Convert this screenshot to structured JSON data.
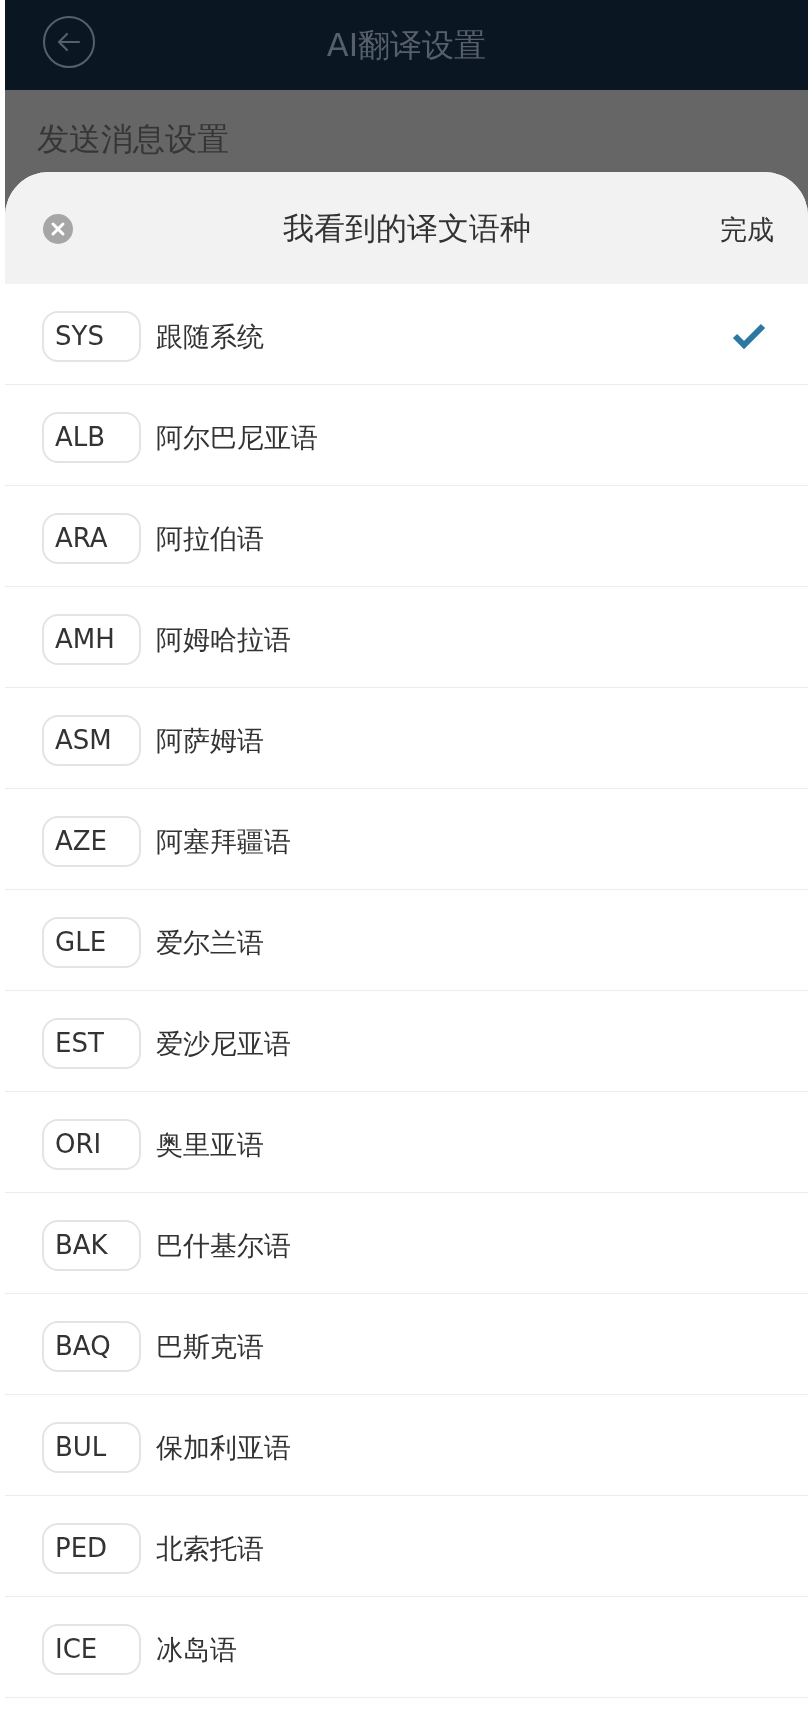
{
  "header": {
    "title": "AI翻译设置"
  },
  "background_section": {
    "title": "发送消息设置"
  },
  "sheet": {
    "title": "我看到的译文语种",
    "done": "完成"
  },
  "languages": [
    {
      "code": "SYS",
      "name": "跟随系统",
      "selected": true
    },
    {
      "code": "ALB",
      "name": "阿尔巴尼亚语",
      "selected": false
    },
    {
      "code": "ARA",
      "name": "阿拉伯语",
      "selected": false
    },
    {
      "code": "AMH",
      "name": "阿姆哈拉语",
      "selected": false
    },
    {
      "code": "ASM",
      "name": "阿萨姆语",
      "selected": false
    },
    {
      "code": "AZE",
      "name": "阿塞拜疆语",
      "selected": false
    },
    {
      "code": "GLE",
      "name": "爱尔兰语",
      "selected": false
    },
    {
      "code": "EST",
      "name": "爱沙尼亚语",
      "selected": false
    },
    {
      "code": "ORI",
      "name": "奥里亚语",
      "selected": false
    },
    {
      "code": "BAK",
      "name": "巴什基尔语",
      "selected": false
    },
    {
      "code": "BAQ",
      "name": "巴斯克语",
      "selected": false
    },
    {
      "code": "BUL",
      "name": "保加利亚语",
      "selected": false
    },
    {
      "code": "PED",
      "name": "北索托语",
      "selected": false
    },
    {
      "code": "ICE",
      "name": "冰岛语",
      "selected": false
    }
  ]
}
